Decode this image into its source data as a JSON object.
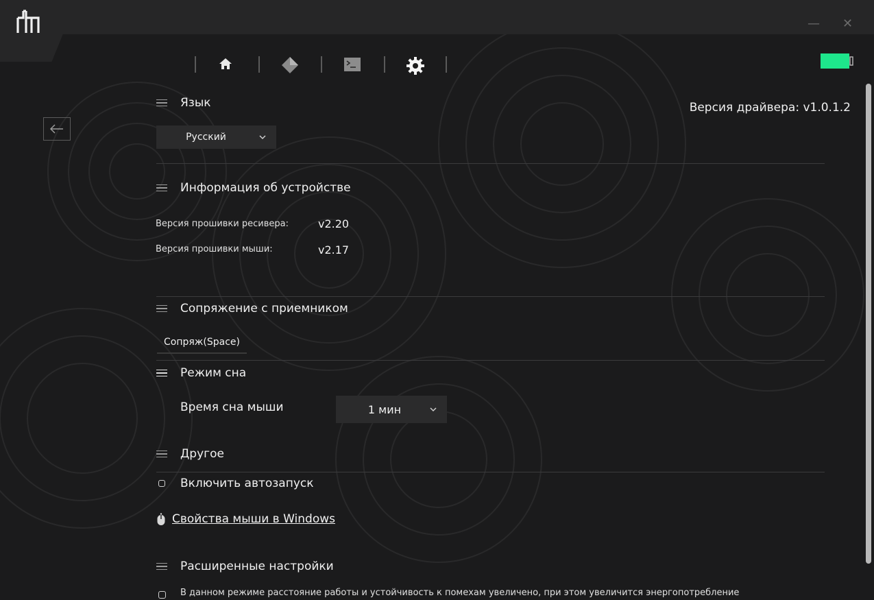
{
  "window": {
    "minimize_glyph": "—",
    "close_glyph": "✕"
  },
  "nav": {
    "icons": [
      "home-icon",
      "diamond-icon",
      "terminal-icon",
      "gear-icon"
    ]
  },
  "colors": {
    "accent": "#1ee68c",
    "background": "#1b1b1c",
    "titlebar": "#262627",
    "dropdown": "#2b2b2c"
  },
  "driver_version": "Версия драйвера: v1.0.1.2",
  "language": {
    "title": "Язык",
    "selected": "Русский"
  },
  "device_info": {
    "title": "Информация об устройстве",
    "receiver_label": "Версия прошивки ресивера:",
    "receiver_value": "v2.20",
    "mouse_label": "Версия прошивки мыши:",
    "mouse_value": "v2.17"
  },
  "pairing": {
    "title": "Сопряжение с приемником",
    "button": "Сопряж(Space)"
  },
  "sleep": {
    "title": "Режим сна",
    "label": "Время сна мыши",
    "selected": "1 мин"
  },
  "other": {
    "title": "Другое",
    "autostart": "Включить автозапуск",
    "mouse_props_link": "Свойства мыши в Windows"
  },
  "advanced": {
    "title": "Расширенные настройки",
    "long_range_text": "В данном режиме расстояние работы и устойчивость к помехам увеличено, при этом увеличится энергопотребление"
  }
}
